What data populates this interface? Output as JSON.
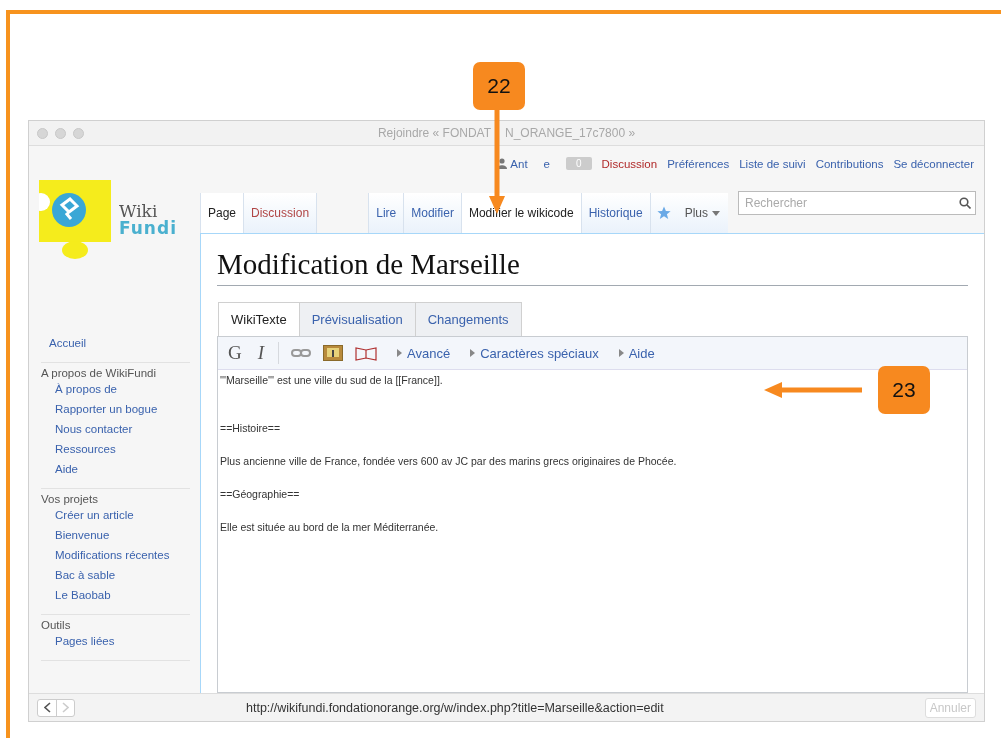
{
  "window": {
    "title_parts": [
      "Rejoindre « FONDAT",
      "N_ORANGE_17c7800 »"
    ]
  },
  "personal_tools": {
    "user_parts": [
      "Ant",
      "e"
    ],
    "notifications": "0",
    "links": [
      {
        "label": "Discussion",
        "kind": "new"
      },
      {
        "label": "Préférences",
        "kind": "link"
      },
      {
        "label": "Liste de suivi",
        "kind": "link"
      },
      {
        "label": "Contributions",
        "kind": "link"
      },
      {
        "label": "Se déconnecter",
        "kind": "link"
      }
    ]
  },
  "logo": {
    "line1": "Wiki",
    "line2": "Fundi"
  },
  "page_tabs": [
    {
      "label": "Page",
      "selected": true,
      "kind": "link"
    },
    {
      "label": "Discussion",
      "selected": false,
      "kind": "new"
    }
  ],
  "view_tabs": [
    {
      "label": "Lire",
      "selected": false
    },
    {
      "label": "Modifier",
      "selected": false
    },
    {
      "label": "Modifier le wikicode",
      "selected": true
    },
    {
      "label": "Historique",
      "selected": false
    }
  ],
  "more_menu": "Plus",
  "search": {
    "placeholder": "Rechercher"
  },
  "heading": "Modification de Marseille",
  "editor": {
    "tabs": [
      {
        "label": "WikiTexte",
        "selected": true
      },
      {
        "label": "Prévisualisation",
        "selected": false
      },
      {
        "label": "Changements",
        "selected": false
      }
    ],
    "toolbar": {
      "bold": "G",
      "italic": "I",
      "sections": [
        "Avancé",
        "Caractères spéciaux",
        "Aide"
      ]
    },
    "lines": [
      {
        "text": "'''Marseille''' est une ville du sud de la [[France]].",
        "kind": "first"
      },
      {
        "text": "==Histoire==",
        "kind": "after_blank2"
      },
      {
        "text": "Plus ancienne ville de France, fondée vers 600 av JC par des marins grecs originaires de Phocée.",
        "kind": "after_blank"
      },
      {
        "text": "==Géographie==",
        "kind": "after_blank"
      },
      {
        "text": "Elle est située au bord de la mer Méditerranée.",
        "kind": "after_blank"
      }
    ]
  },
  "sidebar": {
    "sections": [
      {
        "items": [
          "Accueil"
        ]
      },
      {
        "title": "A propos de WikiFundi",
        "items": [
          "À propos de",
          "Rapporter un bogue",
          "Nous contacter",
          "Ressources",
          "Aide"
        ]
      },
      {
        "title": "Vos projets",
        "items": [
          "Créer un article",
          "Bienvenue",
          "Modifications récentes",
          "Bac à sable",
          "Le Baobab"
        ]
      },
      {
        "title": "Outils",
        "items": [
          "Pages liées"
        ]
      }
    ]
  },
  "status_bar": {
    "back_disabled": false,
    "forward_disabled": true,
    "url": "http://wikifundi.fondationorange.org/w/index.php?title=Marseille&action=edit",
    "cancel": {
      "label": "Annuler",
      "disabled": true
    }
  },
  "callouts": [
    {
      "number": "22",
      "kind": "down"
    },
    {
      "number": "23",
      "kind": "left"
    }
  ]
}
